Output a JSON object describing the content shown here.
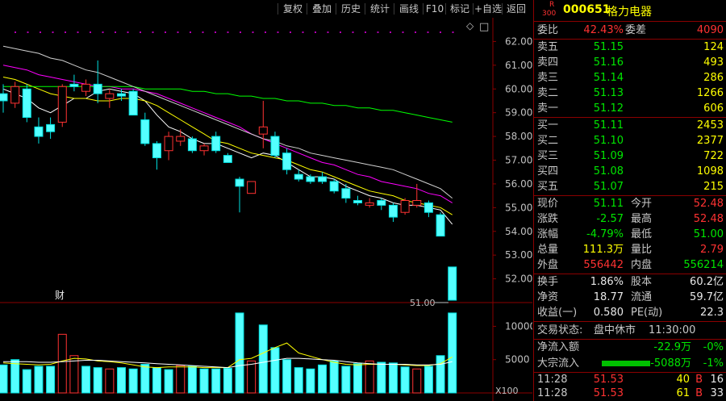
{
  "toolbar": {
    "buttons": [
      {
        "label": "复权"
      },
      {
        "label": "叠加"
      },
      {
        "label": "历史"
      },
      {
        "label": "统计"
      },
      {
        "label": "画线"
      },
      {
        "label": "F10"
      },
      {
        "label": "标记"
      },
      {
        "label": "+自选"
      },
      {
        "label": "返回"
      }
    ]
  },
  "icons": {
    "diamond": "◇",
    "checkbox": "□"
  },
  "chart_data": {
    "type": "candlestick",
    "ylim": [
      51.0,
      63.0
    ],
    "y_ticks": [
      "62.00",
      "61.00",
      "60.00",
      "59.00",
      "58.00",
      "57.00",
      "56.00",
      "55.00",
      "54.00",
      "53.00",
      "52.00"
    ],
    "y_tick_values": [
      62,
      61,
      60,
      59,
      58,
      57,
      56,
      55,
      54,
      53,
      52
    ],
    "price_annotation": "51.00",
    "price_annotation_value": 51.0,
    "event_marker": "财",
    "candles": [
      {
        "o": 59.8,
        "h": 60.2,
        "l": 59.0,
        "c": 59.5
      },
      {
        "o": 59.4,
        "h": 60.3,
        "l": 59.2,
        "c": 60.1
      },
      {
        "o": 60.0,
        "h": 60.2,
        "l": 58.6,
        "c": 58.8
      },
      {
        "o": 58.4,
        "h": 58.8,
        "l": 57.7,
        "c": 58.0
      },
      {
        "o": 58.5,
        "h": 58.8,
        "l": 57.9,
        "c": 58.2
      },
      {
        "o": 58.6,
        "h": 60.2,
        "l": 58.4,
        "c": 60.1
      },
      {
        "o": 60.2,
        "h": 60.6,
        "l": 59.9,
        "c": 60.1
      },
      {
        "o": 59.9,
        "h": 60.4,
        "l": 59.7,
        "c": 60.2
      },
      {
        "o": 60.2,
        "h": 61.2,
        "l": 59.4,
        "c": 59.8
      },
      {
        "o": 59.6,
        "h": 60.0,
        "l": 59.2,
        "c": 59.8
      },
      {
        "o": 59.8,
        "h": 60.0,
        "l": 59.5,
        "c": 59.7
      },
      {
        "o": 59.9,
        "h": 60.0,
        "l": 58.9,
        "c": 58.9
      },
      {
        "o": 58.7,
        "h": 59.0,
        "l": 57.6,
        "c": 57.7
      },
      {
        "o": 57.7,
        "h": 57.8,
        "l": 56.6,
        "c": 57.1
      },
      {
        "o": 57.4,
        "h": 58.2,
        "l": 57.0,
        "c": 58.0
      },
      {
        "o": 57.8,
        "h": 58.3,
        "l": 57.6,
        "c": 58.0
      },
      {
        "o": 57.9,
        "h": 58.0,
        "l": 57.3,
        "c": 57.4
      },
      {
        "o": 57.4,
        "h": 57.7,
        "l": 57.2,
        "c": 57.6
      },
      {
        "o": 58.0,
        "h": 58.2,
        "l": 57.3,
        "c": 57.4
      },
      {
        "o": 57.2,
        "h": 57.3,
        "l": 56.9,
        "c": 56.9
      },
      {
        "o": 56.2,
        "h": 56.3,
        "l": 54.8,
        "c": 55.9
      },
      {
        "o": 55.6,
        "h": 56.0,
        "l": 55.6,
        "c": 56.1
      },
      {
        "o": 58.1,
        "h": 59.5,
        "l": 57.5,
        "c": 58.4
      },
      {
        "o": 58.0,
        "h": 58.2,
        "l": 57.1,
        "c": 57.2
      },
      {
        "o": 57.3,
        "h": 57.5,
        "l": 56.4,
        "c": 56.6
      },
      {
        "o": 56.4,
        "h": 56.6,
        "l": 56.1,
        "c": 56.2
      },
      {
        "o": 56.3,
        "h": 56.4,
        "l": 56.0,
        "c": 56.1
      },
      {
        "o": 56.3,
        "h": 56.5,
        "l": 56.0,
        "c": 56.1
      },
      {
        "o": 56.1,
        "h": 56.2,
        "l": 55.6,
        "c": 55.7
      },
      {
        "o": 55.8,
        "h": 56.0,
        "l": 55.2,
        "c": 55.4
      },
      {
        "o": 55.3,
        "h": 55.5,
        "l": 55.1,
        "c": 55.2
      },
      {
        "o": 55.1,
        "h": 55.4,
        "l": 55.0,
        "c": 55.2
      },
      {
        "o": 55.3,
        "h": 55.4,
        "l": 54.9,
        "c": 55.1
      },
      {
        "o": 55.1,
        "h": 55.2,
        "l": 54.4,
        "c": 54.6
      },
      {
        "o": 54.8,
        "h": 55.4,
        "l": 54.7,
        "c": 55.3
      },
      {
        "o": 55.1,
        "h": 56.0,
        "l": 55.0,
        "c": 55.3
      },
      {
        "o": 55.2,
        "h": 55.3,
        "l": 54.6,
        "c": 54.8
      },
      {
        "o": 54.7,
        "h": 54.8,
        "l": 53.8,
        "c": 53.8
      },
      {
        "o": 52.5,
        "h": 52.5,
        "l": 51.1,
        "c": 51.1
      }
    ],
    "ma_lines": [
      {
        "color": "#ffffff",
        "values": [
          60.0,
          59.8,
          59.6,
          59.2,
          59.0,
          59.3,
          59.6,
          59.6,
          59.9,
          60.0,
          59.9,
          59.8,
          59.5,
          58.9,
          58.4,
          58.2,
          57.9,
          57.7,
          57.7,
          57.5,
          57.3,
          57.1,
          57.3,
          57.2,
          56.9,
          56.6,
          56.3,
          56.3,
          56.2,
          55.9,
          55.7,
          55.5,
          55.4,
          55.2,
          55.1,
          55.1,
          55.0,
          54.9,
          54.3
        ]
      },
      {
        "color": "#ffff00",
        "values": [
          60.5,
          60.4,
          60.2,
          60.0,
          59.8,
          59.7,
          59.6,
          59.6,
          59.5,
          59.5,
          59.6,
          59.6,
          59.5,
          59.3,
          59.0,
          58.7,
          58.4,
          58.1,
          57.8,
          57.7,
          57.5,
          57.3,
          57.2,
          57.1,
          57.0,
          56.8,
          56.6,
          56.5,
          56.3,
          56.1,
          55.9,
          55.7,
          55.6,
          55.5,
          55.3,
          55.2,
          55.1,
          55.0,
          54.7
        ]
      },
      {
        "color": "#ff00ff",
        "values": [
          61.0,
          60.9,
          60.8,
          60.6,
          60.5,
          60.4,
          60.3,
          60.2,
          60.1,
          60.1,
          60.0,
          60.0,
          59.9,
          59.8,
          59.6,
          59.4,
          59.2,
          59.0,
          58.8,
          58.6,
          58.4,
          58.1,
          57.9,
          57.7,
          57.5,
          57.3,
          57.1,
          56.9,
          56.8,
          56.6,
          56.4,
          56.3,
          56.1,
          56.0,
          55.9,
          55.8,
          55.6,
          55.5,
          55.2
        ]
      },
      {
        "color": "#00ff00",
        "values": [
          60.1,
          60.1,
          60.1,
          60.1,
          60.1,
          60.1,
          60.1,
          60.1,
          60.1,
          60.1,
          60.1,
          60.1,
          60.0,
          60.0,
          60.0,
          60.0,
          59.9,
          59.9,
          59.8,
          59.8,
          59.7,
          59.7,
          59.6,
          59.6,
          59.5,
          59.5,
          59.4,
          59.4,
          59.3,
          59.3,
          59.2,
          59.2,
          59.1,
          59.1,
          59.0,
          58.9,
          58.8,
          58.7,
          58.6
        ]
      },
      {
        "color": "#d0d0d0",
        "values": [
          61.8,
          61.7,
          61.6,
          61.5,
          61.3,
          61.2,
          61.0,
          60.8,
          60.7,
          60.5,
          60.3,
          60.1,
          59.9,
          59.7,
          59.5,
          59.3,
          59.1,
          58.9,
          58.7,
          58.5,
          58.3,
          58.1,
          57.9,
          57.8,
          57.6,
          57.5,
          57.3,
          57.2,
          57.1,
          57.0,
          56.9,
          56.8,
          56.7,
          56.6,
          56.4,
          56.2,
          56.0,
          55.8,
          55.4
        ]
      }
    ],
    "volume": {
      "y_ticks": [
        "10000",
        "5000"
      ],
      "y_tick_values": [
        10000,
        5000
      ],
      "ylim": [
        0,
        13200
      ],
      "unit_label": "X100",
      "bars": [
        {
          "v": 4200,
          "up": false
        },
        {
          "v": 5000,
          "up": false
        },
        {
          "v": 3500,
          "up": false
        },
        {
          "v": 4000,
          "up": false
        },
        {
          "v": 4000,
          "up": false
        },
        {
          "v": 8800,
          "up": true
        },
        {
          "v": 5600,
          "up": true
        },
        {
          "v": 4000,
          "up": false
        },
        {
          "v": 3800,
          "up": false
        },
        {
          "v": 3600,
          "up": true
        },
        {
          "v": 3800,
          "up": false
        },
        {
          "v": 3600,
          "up": false
        },
        {
          "v": 4300,
          "up": false
        },
        {
          "v": 3800,
          "up": false
        },
        {
          "v": 3500,
          "up": false
        },
        {
          "v": 4100,
          "up": true
        },
        {
          "v": 4000,
          "up": false
        },
        {
          "v": 3600,
          "up": false
        },
        {
          "v": 3600,
          "up": false
        },
        {
          "v": 3700,
          "up": false
        },
        {
          "v": 12000,
          "up": false
        },
        {
          "v": 4800,
          "up": true
        },
        {
          "v": 10200,
          "up": false
        },
        {
          "v": 6800,
          "up": false
        },
        {
          "v": 5000,
          "up": false
        },
        {
          "v": 3800,
          "up": false
        },
        {
          "v": 3600,
          "up": false
        },
        {
          "v": 4200,
          "up": false
        },
        {
          "v": 4800,
          "up": false
        },
        {
          "v": 4000,
          "up": false
        },
        {
          "v": 4400,
          "up": false
        },
        {
          "v": 4800,
          "up": true
        },
        {
          "v": 4600,
          "up": false
        },
        {
          "v": 4500,
          "up": false
        },
        {
          "v": 3900,
          "up": false
        },
        {
          "v": 3600,
          "up": true
        },
        {
          "v": 4000,
          "up": false
        },
        {
          "v": 5600,
          "up": false
        },
        {
          "v": 12000,
          "up": false
        }
      ],
      "ma_lines": [
        {
          "color": "#ffff00",
          "values": [
            4500,
            4400,
            4300,
            4200,
            4300,
            4800,
            5200,
            5100,
            4800,
            4700,
            4500,
            4200,
            3900,
            3800,
            3900,
            3900,
            3900,
            3800,
            3800,
            3800,
            5000,
            5200,
            6000,
            6800,
            7500,
            6000,
            5500,
            5000,
            4600,
            4300,
            4200,
            4300,
            4300,
            4300,
            4200,
            4100,
            4100,
            4400,
            5400
          ]
        },
        {
          "color": "#ffffff",
          "values": [
            4700,
            4700,
            4700,
            4600,
            4600,
            4700,
            4800,
            4900,
            4900,
            4800,
            4700,
            4600,
            4500,
            4400,
            4300,
            4200,
            4100,
            4000,
            3900,
            3800,
            4100,
            4300,
            4600,
            4900,
            5200,
            5200,
            5100,
            5000,
            4900,
            4700,
            4500,
            4400,
            4300,
            4300,
            4300,
            4200,
            4200,
            4300,
            4700
          ]
        }
      ]
    }
  },
  "quote": {
    "header": {
      "badge_top": "R",
      "badge_bottom": "300",
      "code": "000651",
      "name": "格力电器"
    },
    "weibi": {
      "label": "委比",
      "value": "42.43%",
      "label2": "委差",
      "value2": "4090"
    },
    "sell": [
      {
        "label": "卖五",
        "price": "51.15",
        "vol": "124"
      },
      {
        "label": "卖四",
        "price": "51.16",
        "vol": "493"
      },
      {
        "label": "卖三",
        "price": "51.14",
        "vol": "286"
      },
      {
        "label": "卖二",
        "price": "51.13",
        "vol": "1266"
      },
      {
        "label": "卖一",
        "price": "51.12",
        "vol": "606"
      }
    ],
    "buy": [
      {
        "label": "买一",
        "price": "51.11",
        "vol": "2453"
      },
      {
        "label": "买二",
        "price": "51.10",
        "vol": "2377"
      },
      {
        "label": "买三",
        "price": "51.09",
        "vol": "722"
      },
      {
        "label": "买四",
        "price": "51.08",
        "vol": "1098"
      },
      {
        "label": "买五",
        "price": "51.07",
        "vol": "215"
      }
    ],
    "stats1": [
      {
        "l1": "现价",
        "v1": "51.11",
        "l2": "今开",
        "v2": "52.48"
      },
      {
        "l1": "涨跌",
        "v1": "-2.57",
        "l2": "最高",
        "v2": "52.48"
      },
      {
        "l1": "涨幅",
        "v1": "-4.79%",
        "l2": "最低",
        "v2": "51.00"
      },
      {
        "l1": "总量",
        "v1": "111.3万",
        "l2": "量比",
        "v2": "2.79"
      },
      {
        "l1": "外盘",
        "v1": "556442",
        "l2": "内盘",
        "v2": "556214"
      }
    ],
    "stats2": [
      {
        "l1": "换手",
        "v1": "1.86%",
        "l2": "股本",
        "v2": "60.2亿"
      },
      {
        "l1": "净资",
        "v1": "18.77",
        "l2": "流通",
        "v2": "59.7亿"
      },
      {
        "l1": "收益(一)",
        "v1": "0.580",
        "l2": "PE(动)",
        "v2": "22.3"
      }
    ],
    "trade_status": {
      "label": "交易状态:",
      "status": "盘中休市",
      "time": "11:30:00"
    },
    "flow": [
      {
        "label": "净流入额",
        "value": "-22.9万",
        "pct": "-0%",
        "bar": 0.0
      },
      {
        "label": "大宗流入",
        "value": "-5088万",
        "pct": "-1%",
        "bar": 1.0
      }
    ],
    "ticks": [
      {
        "time": "11:28",
        "price": "51.53",
        "vol": "40",
        "side": "B",
        "count": "16"
      },
      {
        "time": "11:28",
        "price": "51.53",
        "vol": "61",
        "side": "B",
        "count": "33"
      }
    ]
  },
  "colors": {
    "up": "#ff3232",
    "down": "#54ffff",
    "down_stroke": "#00e0e0",
    "grid": "#8b0000",
    "dot": "#b000b0",
    "panel_bg": "#000000"
  }
}
